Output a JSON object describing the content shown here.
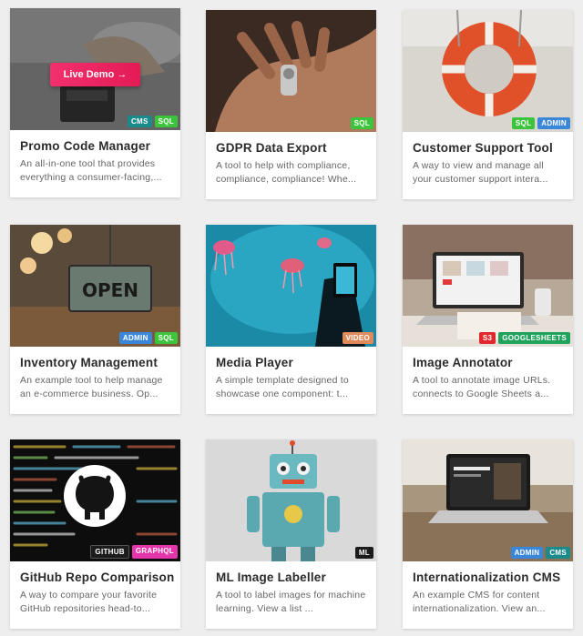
{
  "cards": [
    {
      "title": "Promo Code Manager",
      "desc": "An all-in-one tool that provides everything a consumer-facing,...",
      "tags": [
        {
          "label": "CMS",
          "color": "#1a8a8a"
        },
        {
          "label": "SQL",
          "color": "#3cc43c"
        }
      ],
      "demo_label": "Live Demo →"
    },
    {
      "title": "GDPR Data Export",
      "desc": "A tool to help with compliance, compliance, compliance! Whe...",
      "tags": [
        {
          "label": "SQL",
          "color": "#3cc43c"
        }
      ]
    },
    {
      "title": "Customer Support Tool",
      "desc": "A way to view and manage all your customer support intera...",
      "tags": [
        {
          "label": "SQL",
          "color": "#3cc43c"
        },
        {
          "label": "ADMIN",
          "color": "#3a86d8"
        }
      ]
    },
    {
      "title": "Inventory Management",
      "desc": "An example tool to help manage an e-commerce business. Op...",
      "tags": [
        {
          "label": "ADMIN",
          "color": "#3a86d8"
        },
        {
          "label": "SQL",
          "color": "#3cc43c"
        }
      ]
    },
    {
      "title": "Media Player",
      "desc": "A simple template designed to showcase one component: t...",
      "tags": [
        {
          "label": "VIDEO",
          "color": "#e08a5c"
        }
      ]
    },
    {
      "title": "Image Annotator",
      "desc": "A tool to annotate image URLs. connects to Google Sheets a...",
      "tags": [
        {
          "label": "S3",
          "color": "#e0282e"
        },
        {
          "label": "GOOGLESHEETS",
          "color": "#1fa25a"
        }
      ]
    },
    {
      "title": "GitHub Repo Comparison",
      "desc": "A way to compare your favorite GitHub repositories head-to...",
      "tags": [
        {
          "label": "GITHUB",
          "color": "#1b1b1b"
        },
        {
          "label": "GRAPHQL",
          "color": "#e535ab"
        }
      ]
    },
    {
      "title": "ML Image Labeller",
      "desc": "A tool to label images for machine learning. View a list ...",
      "tags": [
        {
          "label": "ML",
          "color": "#1b1b1b"
        }
      ]
    },
    {
      "title": "Internationalization CMS",
      "desc": "An example CMS for content internationalization. View an...",
      "tags": [
        {
          "label": "ADMIN",
          "color": "#3a86d8"
        },
        {
          "label": "CMS",
          "color": "#1a8a8a"
        }
      ]
    }
  ]
}
